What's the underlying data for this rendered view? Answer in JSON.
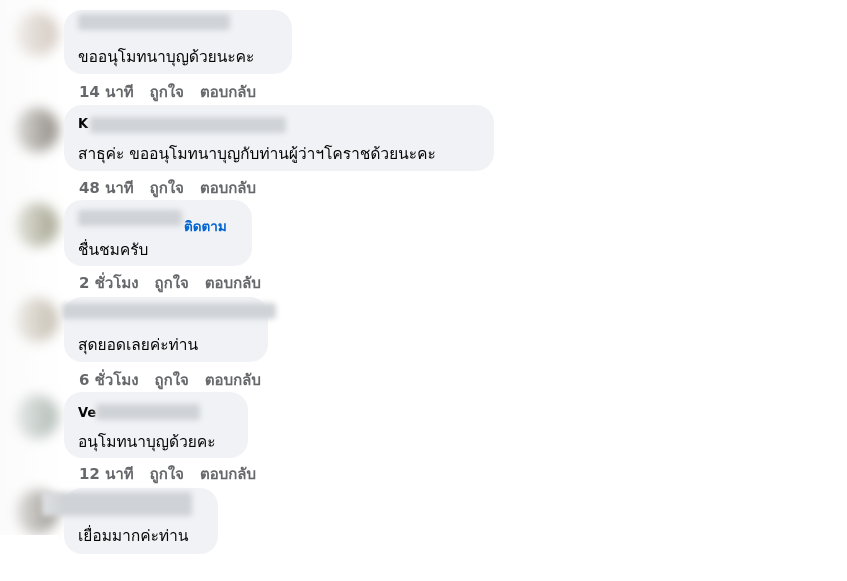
{
  "comments": [
    {
      "text": "ขออนุโมทนาบุญด้วยนะคะ",
      "time": "14 นาที",
      "like_label": "ถูกใจ",
      "reply_label": "ตอบกลับ"
    },
    {
      "name_prefix": "K",
      "text": "สาธุค่ะ ขออนุโมทนาบุญกับท่านผู้ว่าฯโคราชด้วยนะคะ",
      "time": "48 นาที",
      "like_label": "ถูกใจ",
      "reply_label": "ตอบกลับ"
    },
    {
      "follow_label": "ติดตาม",
      "text": "ชื่นชมครับ",
      "time": "2 ชั่วโมง",
      "like_label": "ถูกใจ",
      "reply_label": "ตอบกลับ"
    },
    {
      "text": "สุดยอดเลยค่ะท่าน",
      "time": "6 ชั่วโมง",
      "like_label": "ถูกใจ",
      "reply_label": "ตอบกลับ"
    },
    {
      "name_prefix": "Ve",
      "text": "อนุโมทนาบุญด้วยคะ",
      "time": "12 นาที",
      "like_label": "ถูกใจ",
      "reply_label": "ตอบกลับ"
    },
    {
      "text": "เยื่อมมากค่ะท่าน"
    }
  ]
}
